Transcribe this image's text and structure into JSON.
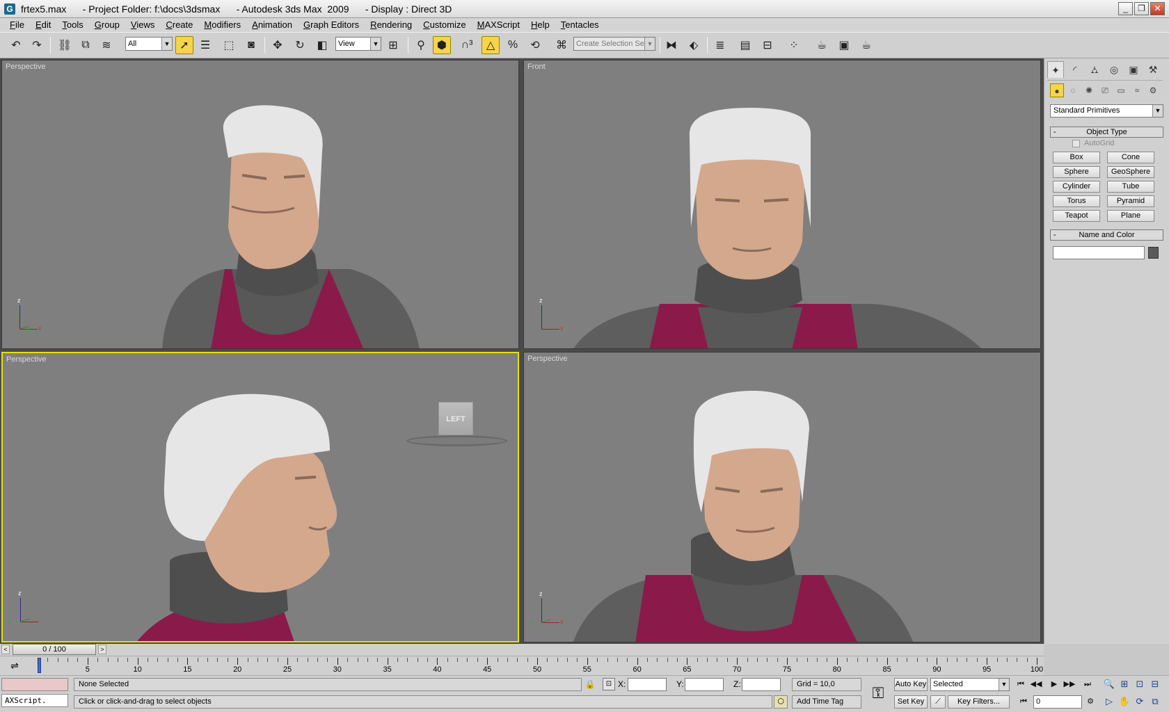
{
  "window": {
    "title": "frtex5.max      - Project Folder: f:\\docs\\3dsmax      - Autodesk 3ds Max  2009      - Display : Direct 3D",
    "app_icon": "G"
  },
  "menu": [
    "File",
    "Edit",
    "Tools",
    "Group",
    "Views",
    "Create",
    "Modifiers",
    "Animation",
    "Graph Editors",
    "Rendering",
    "Customize",
    "MAXScript",
    "Help",
    "Tentacles"
  ],
  "toolbar": {
    "selection_filter": "All",
    "reference_coord": "View",
    "named_selection_placeholder": "Create Selection Set"
  },
  "viewports": [
    {
      "label": "Perspective",
      "active": false
    },
    {
      "label": "Front",
      "active": false
    },
    {
      "label": "Perspective",
      "active": true
    },
    {
      "label": "Perspective",
      "active": false
    }
  ],
  "viewcube_label": "LEFT",
  "axis_labels": {
    "x": "x",
    "y": "y",
    "z": "z"
  },
  "command_panel": {
    "category": "Standard Primitives",
    "object_type_title": "Object Type",
    "autogrid_label": "AutoGrid",
    "primitives": [
      "Box",
      "Cone",
      "Sphere",
      "GeoSphere",
      "Cylinder",
      "Tube",
      "Torus",
      "Pyramid",
      "Teapot",
      "Plane"
    ],
    "name_color_title": "Name and Color",
    "rollout_toggle": "-"
  },
  "time_slider": {
    "label": "0 / 100",
    "prev": "<",
    "next": ">"
  },
  "timeline": {
    "ticks": [
      0,
      5,
      10,
      15,
      20,
      25,
      30,
      35,
      40,
      45,
      50,
      55,
      60,
      65,
      70,
      75,
      80,
      85,
      90,
      95,
      100
    ],
    "current_frame": 0
  },
  "status": {
    "selection": "None Selected",
    "prompt": "Click or click-and-drag to select objects",
    "maxscript": "AXScript.",
    "x_label": "X:",
    "y_label": "Y:",
    "z_label": "Z:",
    "grid": "Grid = 10,0",
    "add_time_tag": "Add Time Tag",
    "auto_key": "Auto Key",
    "set_key": "Set Key",
    "key_mode": "Selected",
    "key_filters": "Key Filters...",
    "current_frame": "0"
  },
  "colors": {
    "viewport_bg": "#7f7f7f",
    "active_border": "#e8e000",
    "helmet": "#e8e8e8",
    "skin": "#d4a88c",
    "collar": "#5c5c5c",
    "vest": "#8a1a4a",
    "shoulders": "#606060"
  }
}
